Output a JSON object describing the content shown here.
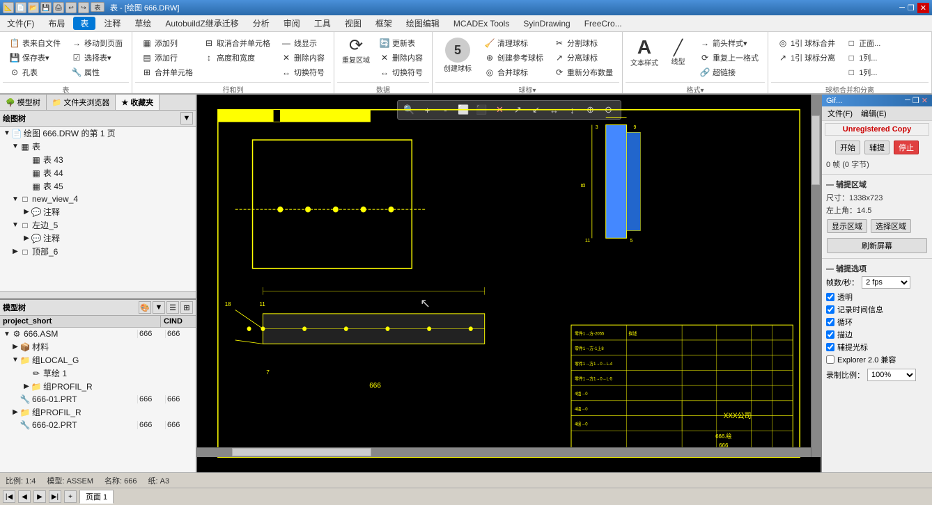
{
  "app": {
    "title": "GIF...",
    "window_controls": [
      "minimize",
      "restore",
      "close"
    ]
  },
  "titlebar": {
    "icons": [
      "new",
      "open",
      "save",
      "print",
      "undo",
      "redo"
    ],
    "title": "表 - [绘图 666.DRW]"
  },
  "menubar": {
    "items": [
      "文件(F)",
      "布局",
      "表",
      "注释",
      "草绘",
      "AutobuildZ继承迁移",
      "分析",
      "审阅",
      "工具",
      "视图",
      "框架",
      "绘图编辑",
      "MCADEx Tools",
      "SyinDrawing",
      "FreeCrо..."
    ]
  },
  "tabs": {
    "active": "表",
    "items": [
      "文件",
      "布局",
      "表",
      "注释",
      "草绘",
      "AutobuildZ继承迁移",
      "分析",
      "审阅",
      "工具",
      "视图",
      "框架",
      "绘图编辑",
      "MCADEx Tools",
      "SyinDrawing",
      "FreeCrо..."
    ]
  },
  "ribbon": {
    "groups": [
      {
        "name": "表",
        "buttons": [
          {
            "label": "表来自文件",
            "icon": "📋"
          },
          {
            "label": "保存表▾",
            "icon": "💾"
          },
          {
            "label": "孔表",
            "icon": "⊙"
          },
          {
            "label": "移动到页面",
            "icon": "→"
          },
          {
            "label": "选择表▾",
            "icon": "☑"
          },
          {
            "label": "属性",
            "icon": "🔧"
          }
        ]
      },
      {
        "name": "行和列",
        "buttons": [
          {
            "label": "添加列",
            "icon": "▦"
          },
          {
            "label": "添加行",
            "icon": "▤"
          },
          {
            "label": "合并单元格",
            "icon": "⊞"
          },
          {
            "label": "取消合并单元格",
            "icon": "⊟"
          },
          {
            "label": "高度和宽度",
            "icon": "↕"
          },
          {
            "label": "线显示",
            "icon": "—"
          },
          {
            "label": "删除内容",
            "icon": "✕"
          },
          {
            "label": "切换符号",
            "icon": "↔"
          }
        ]
      },
      {
        "name": "数据",
        "buttons": [
          {
            "label": "重复区域",
            "icon": "⟳"
          },
          {
            "label": "更新表",
            "icon": "🔄"
          },
          {
            "label": "删除内容",
            "icon": "✕"
          },
          {
            "label": "切换符号",
            "icon": "↔"
          }
        ]
      },
      {
        "name": "球标▾",
        "buttons": [
          {
            "label": "创建球标",
            "icon": "⑤",
            "large": true
          },
          {
            "label": "清理球标",
            "icon": "🧹"
          },
          {
            "label": "创建参考球标",
            "icon": "⊕"
          },
          {
            "label": "合并球标",
            "icon": "◎"
          },
          {
            "label": "分割球标",
            "icon": "✂"
          },
          {
            "label": "分离球标",
            "icon": "↗"
          },
          {
            "label": "重新分布数量",
            "icon": "⟳"
          }
        ]
      },
      {
        "name": "格式▾",
        "buttons": [
          {
            "label": "文本样式",
            "icon": "A"
          },
          {
            "label": "线型",
            "icon": "—"
          },
          {
            "label": "箭头样式▾",
            "icon": "→"
          },
          {
            "label": "重复上一格式",
            "icon": "⟳"
          },
          {
            "label": "超链接",
            "icon": "🔗"
          }
        ]
      },
      {
        "name": "球标合并和分离",
        "buttons": [
          {
            "label": "1引 球标合井",
            "icon": "◎"
          },
          {
            "label": "1引 球标分离",
            "icon": "↗"
          },
          {
            "label": "正面...",
            "icon": "□"
          },
          {
            "label": "1列...",
            "icon": "□"
          },
          {
            "label": "1列...",
            "icon": "□"
          }
        ]
      }
    ]
  },
  "left_panel": {
    "tabs": [
      {
        "label": "模型树",
        "icon": "🌳",
        "active": false
      },
      {
        "label": "文件夹浏览器",
        "icon": "📁",
        "active": false
      },
      {
        "label": "收藏夹",
        "icon": "★",
        "active": true
      }
    ],
    "section_title": "绘图树",
    "tree": {
      "root": "绘图 666.DRW 的第 1 页",
      "items": [
        {
          "label": "表",
          "level": 0,
          "expandable": true,
          "expanded": true
        },
        {
          "label": "表 43",
          "level": 1,
          "icon": "▦"
        },
        {
          "label": "表 44",
          "level": 1,
          "icon": "▦"
        },
        {
          "label": "表 45",
          "level": 1,
          "icon": "▦"
        },
        {
          "label": "new_view_4",
          "level": 0,
          "expandable": true,
          "expanded": true,
          "icon": "□"
        },
        {
          "label": "注释",
          "level": 1,
          "expandable": true
        },
        {
          "label": "左边_5",
          "level": 0,
          "expandable": true,
          "expanded": true,
          "icon": "□"
        },
        {
          "label": "注释",
          "level": 1,
          "expandable": true
        },
        {
          "label": "顶部_6",
          "level": 0,
          "expandable": true,
          "icon": "□"
        }
      ]
    }
  },
  "model_tree": {
    "header": "模型树",
    "columns": [
      "project_short",
      "CIND"
    ],
    "rows": [
      {
        "name": "666.ASM",
        "short": "666",
        "cind": "666",
        "icon": "⚙",
        "level": 0
      },
      {
        "name": "材料",
        "short": "",
        "cind": "",
        "icon": "📦",
        "level": 1,
        "expandable": true
      },
      {
        "name": "组LOCAL_G",
        "short": "",
        "cind": "",
        "icon": "📁",
        "level": 1,
        "expandable": true
      },
      {
        "name": "草绘 1",
        "short": "",
        "cind": "",
        "icon": "✏",
        "level": 2
      },
      {
        "name": "组PROFIL_R",
        "short": "",
        "cind": "",
        "icon": "📁",
        "level": 2,
        "expandable": true
      },
      {
        "name": "666-01.PRT",
        "short": "666",
        "cind": "666",
        "icon": "🔧",
        "level": 1
      },
      {
        "name": "组PROFIL_R",
        "short": "",
        "cind": "",
        "icon": "📁",
        "level": 1,
        "expandable": true
      },
      {
        "name": "666-02.PRT",
        "short": "666",
        "cind": "666",
        "icon": "🔧",
        "level": 1
      }
    ]
  },
  "canvas": {
    "background": "#000000",
    "drawing_color": "#ffff00",
    "zoom_buttons": [
      "🔍",
      "🔍+",
      "🔍-",
      "⬜",
      "⬜",
      "✕",
      "↗",
      "↙",
      "↔",
      "↕",
      "⊕",
      "⊖"
    ]
  },
  "status_bar": {
    "scale": "比例: 1:4",
    "model": "模型: ASSEM",
    "name": "名称: 666",
    "paper": "纸: A3"
  },
  "page_nav": {
    "pages": [
      "页面 1"
    ]
  },
  "right_panel": {
    "title": "Gif...",
    "menu": [
      "文件(F)",
      "编辑(E)"
    ],
    "unregistered": "Unregistered Copy",
    "buttons": [
      "开始",
      "辅提",
      "停止"
    ],
    "frame_info": "0 帧 (0 字节)",
    "capture_section": "— 辅提区域",
    "size": "尺寸：1338x723",
    "top_left": "左上角：14.5",
    "show_region_btn": "显示区域",
    "select_region_btn": "选择区域",
    "refresh_btn": "刷新屏幕",
    "options_section": "— 辅提选项",
    "fps_label": "帧数/秒：",
    "fps_value": "2 fps",
    "checkboxes": [
      {
        "label": "透明",
        "checked": true
      },
      {
        "label": "记录时间信息",
        "checked": true
      },
      {
        "label": "循环",
        "checked": true
      },
      {
        "label": "描边",
        "checked": true
      },
      {
        "label": "辅提光标",
        "checked": true
      },
      {
        "label": "Explorer 2.0 兼容",
        "checked": false
      }
    ],
    "scale_label": "录制比例：",
    "scale_value": "100%"
  }
}
